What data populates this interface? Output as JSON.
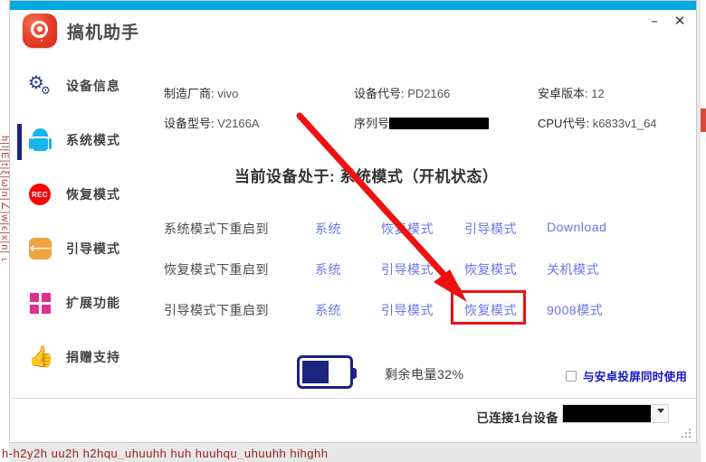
{
  "window": {
    "brand_name": "搞机助手",
    "minimize_label": "–",
    "close_label": "✕",
    "accent_color": "#00a8e1"
  },
  "sidebar": {
    "items": [
      {
        "label": "设备信息",
        "icon": "gear-icon",
        "active": true,
        "color": "#2b3a8f"
      },
      {
        "label": "系统模式",
        "icon": "android-icon",
        "active": false,
        "color": "#18b4f0"
      },
      {
        "label": "恢复模式",
        "icon": "rec-icon",
        "active": false,
        "color": "#f50505"
      },
      {
        "label": "引导模式",
        "icon": "back-arrow-icon",
        "active": false,
        "color": "#eea240"
      },
      {
        "label": "扩展功能",
        "icon": "grid-icon",
        "active": false,
        "color": "#e0308f"
      },
      {
        "label": "捐赠支持",
        "icon": "thumbs-up-icon",
        "active": false,
        "color": "#3bb16f"
      }
    ],
    "rec_icon_text": "REC"
  },
  "device_info": [
    {
      "label": "制造厂商:",
      "value": "vivo",
      "redacted": false
    },
    {
      "label": "设备代号:",
      "value": "PD2166",
      "redacted": false
    },
    {
      "label": "安卓版本:",
      "value": "12",
      "redacted": false
    },
    {
      "label": "设备型号:",
      "value": "V2166A",
      "redacted": false
    },
    {
      "label": "序列号",
      "value": "",
      "redacted": true
    },
    {
      "label": "CPU代号:",
      "value": "k6833v1_64",
      "redacted": false
    }
  ],
  "status_line": "当前设备处于: 系统模式（开机状态）",
  "mode_rows": [
    {
      "caption": "系统模式下重启到",
      "links": [
        "系统",
        "恢复模式",
        "引导模式",
        "Download"
      ]
    },
    {
      "caption": "恢复模式下重启到",
      "links": [
        "系统",
        "引导模式",
        "恢复模式",
        "关机模式"
      ]
    },
    {
      "caption": "引导模式下重启到",
      "links": [
        "系统",
        "引导模式",
        "恢复模式",
        "9008模式"
      ]
    }
  ],
  "highlight": {
    "row_index": 2,
    "link_index": 2,
    "link_label": "恢复模式",
    "box_color": "#ee1111",
    "arrow_color": "#ee1111"
  },
  "battery": {
    "percent": 32,
    "text": "剩余电量32%",
    "color": "#1a237e"
  },
  "checkbox": {
    "label": "与安卓投屏同时使用",
    "checked": false,
    "color": "#1414c8"
  },
  "statusbar": {
    "connection_text": "已连接1台设备",
    "device_value": "",
    "device_redacted": true
  },
  "background": {
    "bottom_text": "h-h2y2h  uu2h  h2hqu_uhuuhh  huh  huuhqu_uhuuhh hihghh",
    "left_text": "h|l|E|t|ξ|ω|n|∠|w|ϵ|x|n|⌐"
  }
}
